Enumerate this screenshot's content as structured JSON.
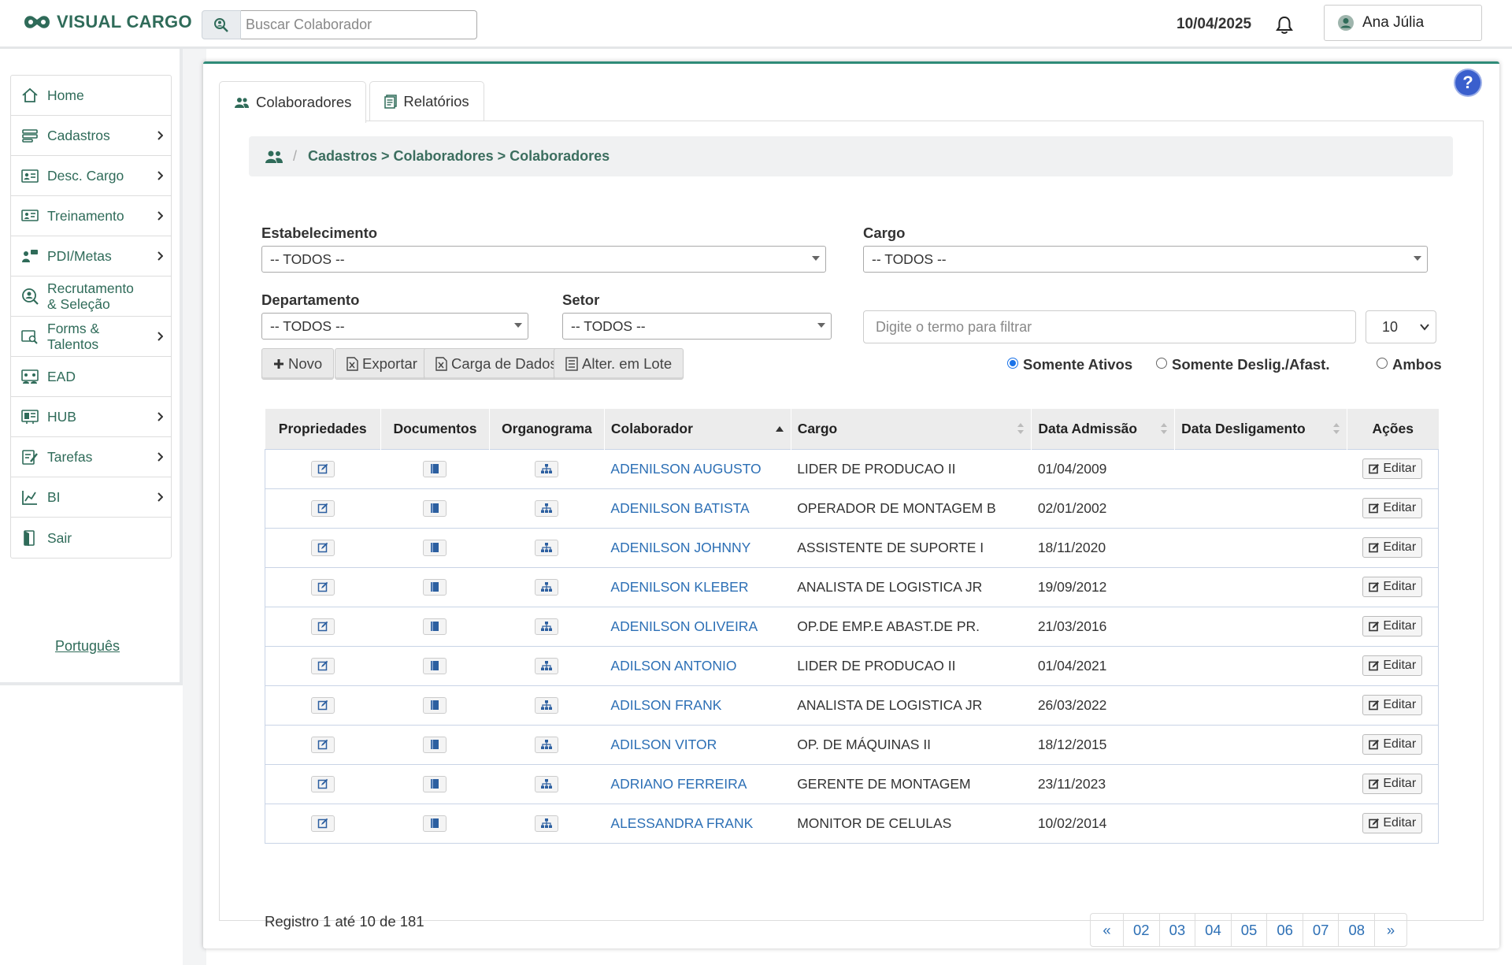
{
  "app": {
    "logo_text": "VISUAL CARGO"
  },
  "header": {
    "search_placeholder": "Buscar Colaborador",
    "date": "10/04/2025",
    "user_name": "Ana Júlia"
  },
  "sidebar": {
    "items": [
      {
        "label": "Home",
        "icon": "home-icon",
        "has_submenu": false
      },
      {
        "label": "Cadastros",
        "icon": "list-icon",
        "has_submenu": true
      },
      {
        "label": "Desc. Cargo",
        "icon": "id-card-icon",
        "has_submenu": true
      },
      {
        "label": "Treinamento",
        "icon": "training-board-icon",
        "has_submenu": true
      },
      {
        "label": "PDI/Metas",
        "icon": "person-chat-icon",
        "has_submenu": true
      },
      {
        "label": "Recrutamento & Seleção",
        "icon": "user-search-icon",
        "has_submenu": false
      },
      {
        "label": "Forms & Talentos",
        "icon": "form-search-icon",
        "has_submenu": true
      },
      {
        "label": "EAD",
        "icon": "presentation-icon",
        "has_submenu": false
      },
      {
        "label": "HUB",
        "icon": "hub-icon",
        "has_submenu": true
      },
      {
        "label": "Tarefas",
        "icon": "tasks-icon",
        "has_submenu": true
      },
      {
        "label": "BI",
        "icon": "chart-icon",
        "has_submenu": true
      },
      {
        "label": "Sair",
        "icon": "exit-icon",
        "has_submenu": false
      }
    ],
    "language": "Português"
  },
  "tabs": [
    {
      "label": "Colaboradores",
      "active": true
    },
    {
      "label": "Relatórios",
      "active": false
    }
  ],
  "breadcrumb": "Cadastros > Colaboradores > Colaboradores",
  "filters": {
    "estabelecimento": {
      "label": "Estabelecimento",
      "value": "-- TODOS --"
    },
    "cargo": {
      "label": "Cargo",
      "value": "-- TODOS --"
    },
    "departamento": {
      "label": "Departamento",
      "value": "-- TODOS --"
    },
    "setor": {
      "label": "Setor",
      "value": "-- TODOS --"
    },
    "term_placeholder": "Digite o termo para filtrar",
    "page_size": "10"
  },
  "buttons": {
    "novo": "Novo",
    "exportar": "Exportar",
    "carga": "Carga de Dados",
    "lote": "Alter. em Lote"
  },
  "radios": {
    "ativos": "Somente Ativos",
    "deslig": "Somente Deslig./Afast.",
    "ambos": "Ambos",
    "selected": "ativos"
  },
  "table": {
    "headers": {
      "propriedades": "Propriedades",
      "documentos": "Documentos",
      "organograma": "Organograma",
      "colaborador": "Colaborador",
      "cargo": "Cargo",
      "admissao": "Data Admissão",
      "desligamento": "Data Desligamento",
      "acoes": "Ações"
    },
    "edit_label": "Editar",
    "rows": [
      {
        "name": "ADENILSON AUGUSTO",
        "cargo": "LIDER DE PRODUCAO II",
        "admissao": "01/04/2009",
        "desligamento": ""
      },
      {
        "name": "ADENILSON BATISTA",
        "cargo": "OPERADOR DE MONTAGEM B",
        "admissao": "02/01/2002",
        "desligamento": ""
      },
      {
        "name": "ADENILSON JOHNNY",
        "cargo": "ASSISTENTE DE SUPORTE I",
        "admissao": "18/11/2020",
        "desligamento": ""
      },
      {
        "name": "ADENILSON KLEBER",
        "cargo": "ANALISTA DE LOGISTICA JR",
        "admissao": "19/09/2012",
        "desligamento": ""
      },
      {
        "name": "ADENILSON OLIVEIRA",
        "cargo": "OP.DE EMP.E ABAST.DE PR.",
        "admissao": "21/03/2016",
        "desligamento": ""
      },
      {
        "name": "ADILSON ANTONIO",
        "cargo": "LIDER DE PRODUCAO II",
        "admissao": "01/04/2021",
        "desligamento": ""
      },
      {
        "name": "ADILSON FRANK",
        "cargo": "ANALISTA DE LOGISTICA JR",
        "admissao": "26/03/2022",
        "desligamento": ""
      },
      {
        "name": "ADILSON VITOR",
        "cargo": "OP. DE MÁQUINAS II",
        "admissao": "18/12/2015",
        "desligamento": ""
      },
      {
        "name": "ADRIANO FERREIRA",
        "cargo": "GERENTE DE MONTAGEM",
        "admissao": "23/11/2023",
        "desligamento": ""
      },
      {
        "name": "ALESSANDRA FRANK",
        "cargo": "MONITOR DE CELULAS",
        "admissao": "10/02/2014",
        "desligamento": ""
      }
    ]
  },
  "footer": {
    "records": "Registro 1 até 10 de 181",
    "pages": [
      "«",
      "02",
      "03",
      "04",
      "05",
      "06",
      "07",
      "08",
      "»"
    ]
  },
  "colors": {
    "brand": "#2f6b59",
    "link": "#2c6fb5",
    "accent": "#2f8b78"
  }
}
